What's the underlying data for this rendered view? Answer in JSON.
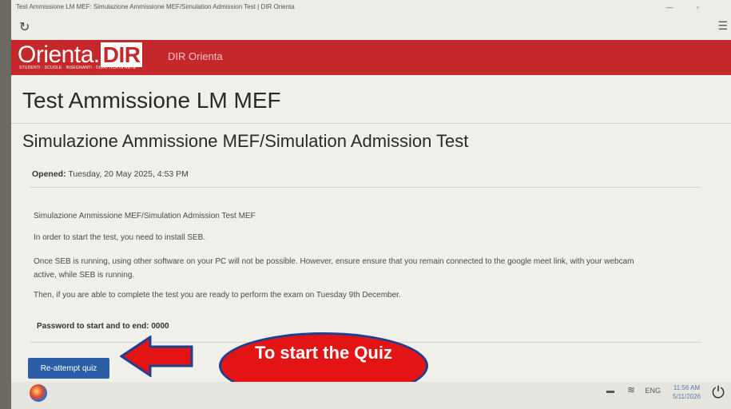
{
  "window": {
    "title": "Test Ammissione LM MEF: Simulazione Ammissione MEF/Simulation Admission Test | DIR Orienta"
  },
  "header": {
    "logo_text": "Orienta",
    "logo_dot": ".",
    "logo_dir": "DIR",
    "logo_tagline": "STUDENTI · SCUOLE · INSEGNANTI · DIDATTICA IN RETE",
    "brand": "DIR Orienta"
  },
  "main": {
    "page_title": "Test Ammissione LM MEF",
    "subtitle": "Simulazione Ammissione MEF/Simulation Admission Test",
    "opened_label": "Opened:",
    "opened_value": "Tuesday, 20 May 2025, 4:53 PM",
    "paragraphs": [
      "Simulazione Ammissione MEF/Simulation Admission Test MEF",
      "In order to start the test, you need to install SEB.",
      "Once SEB is running, using other software on your PC will not be possible. However, ensure ensure that you remain connected to the google meet link, with your webcam active, while SEB is running.",
      "Then, if you are able to complete the test you are ready to perform the exam on Tuesday 9th December."
    ],
    "password_text": "Password to start and to end: 0000",
    "reattempt_label": "Re-attempt quiz"
  },
  "annotation": {
    "callout_text": "To start the Quiz",
    "arrow_color": "#e41414"
  },
  "taskbar": {
    "language": "ENG",
    "time": "11:56 AM",
    "date": "5/11/2026"
  },
  "colors": {
    "header_red": "#c4282a",
    "button_blue": "#2a5fa8",
    "callout_red": "#e41414"
  }
}
